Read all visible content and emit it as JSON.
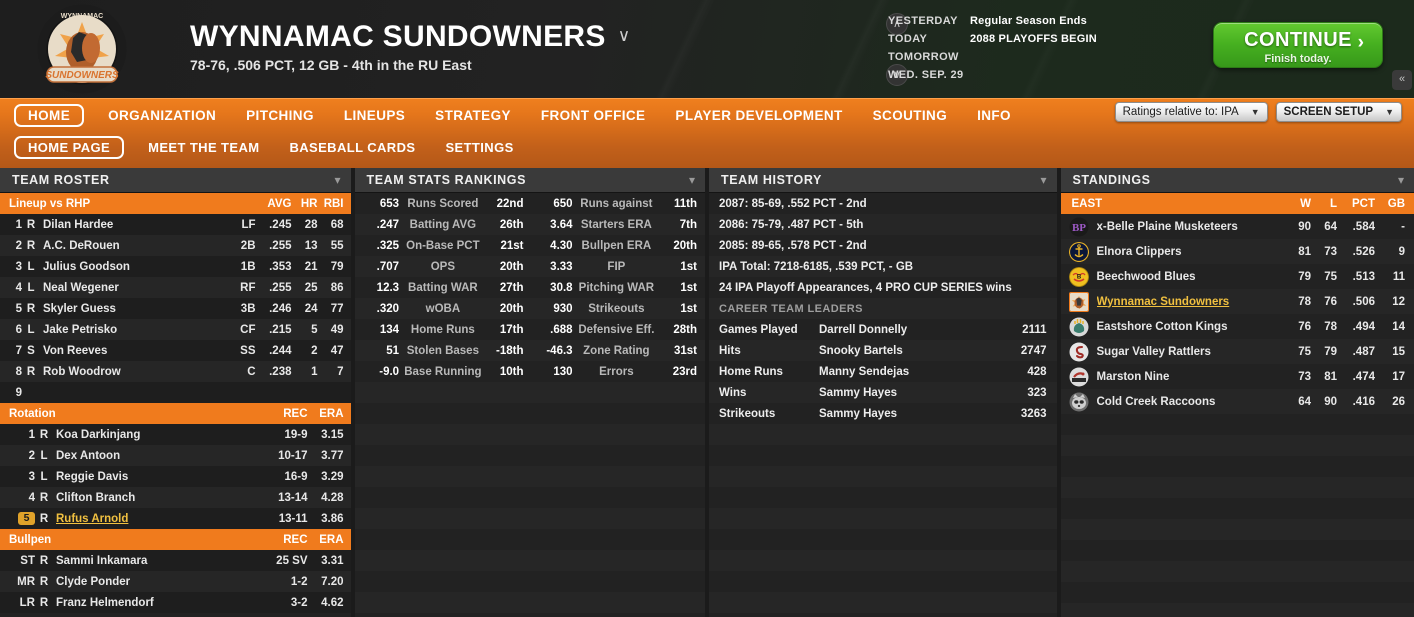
{
  "header": {
    "team_name": "WYNNAMAC SUNDOWNERS",
    "team_record": "78-76, .506 PCT, 12 GB - 4th in the RU East",
    "title_chevron": "chevron-down-icon",
    "dates": [
      {
        "label": "YESTERDAY",
        "value": "Regular Season Ends"
      },
      {
        "label": "TODAY",
        "value": "2088 PLAYOFFS BEGIN"
      },
      {
        "label": "TOMORROW",
        "value": ""
      },
      {
        "label": "WED. SEP. 29",
        "value": ""
      }
    ],
    "continue_label": "CONTINUE",
    "continue_sub": "Finish today.",
    "continue_arrow": "›",
    "collapse_icon": "«",
    "up_icon": "∧",
    "down_icon": "∨",
    "continue_color": "#46b020"
  },
  "nav": {
    "primary": [
      {
        "label": "HOME",
        "active": true
      },
      {
        "label": "ORGANIZATION",
        "active": false
      },
      {
        "label": "PITCHING",
        "active": false
      },
      {
        "label": "LINEUPS",
        "active": false
      },
      {
        "label": "STRATEGY",
        "active": false
      },
      {
        "label": "FRONT OFFICE",
        "active": false
      },
      {
        "label": "PLAYER DEVELOPMENT",
        "active": false
      },
      {
        "label": "SCOUTING",
        "active": false
      },
      {
        "label": "INFO",
        "active": false
      }
    ],
    "secondary": [
      {
        "label": "HOME PAGE",
        "active": true
      },
      {
        "label": "MEET THE TEAM",
        "active": false
      },
      {
        "label": "BASEBALL CARDS",
        "active": false
      },
      {
        "label": "SETTINGS",
        "active": false
      }
    ],
    "ratings_select": "Ratings relative to: IPA",
    "screen_setup_select": "SCREEN SETUP",
    "accent_color": "#ef7f1e"
  },
  "roster": {
    "panel_title": "TEAM ROSTER",
    "lineup_header": {
      "label": "Lineup vs RHP",
      "avg": "AVG",
      "hr": "HR",
      "rbi": "RBI"
    },
    "lineup": [
      {
        "num": "1",
        "hand": "R",
        "name": "Dilan Hardee",
        "pos": "LF",
        "avg": ".245",
        "hr": "28",
        "rbi": "68"
      },
      {
        "num": "2",
        "hand": "R",
        "name": "A.C. DeRouen",
        "pos": "2B",
        "avg": ".255",
        "hr": "13",
        "rbi": "55"
      },
      {
        "num": "3",
        "hand": "L",
        "name": "Julius Goodson",
        "pos": "1B",
        "avg": ".353",
        "hr": "21",
        "rbi": "79"
      },
      {
        "num": "4",
        "hand": "L",
        "name": "Neal Wegener",
        "pos": "RF",
        "avg": ".255",
        "hr": "25",
        "rbi": "86"
      },
      {
        "num": "5",
        "hand": "R",
        "name": "Skyler Guess",
        "pos": "3B",
        "avg": ".246",
        "hr": "24",
        "rbi": "77"
      },
      {
        "num": "6",
        "hand": "L",
        "name": "Jake Petrisko",
        "pos": "CF",
        "avg": ".215",
        "hr": "5",
        "rbi": "49"
      },
      {
        "num": "7",
        "hand": "S",
        "name": "Von Reeves",
        "pos": "SS",
        "avg": ".244",
        "hr": "2",
        "rbi": "47"
      },
      {
        "num": "8",
        "hand": "R",
        "name": "Rob Woodrow",
        "pos": "C",
        "avg": ".238",
        "hr": "1",
        "rbi": "7"
      },
      {
        "num": "9",
        "hand": "",
        "name": "",
        "pos": "",
        "avg": "",
        "hr": "",
        "rbi": ""
      }
    ],
    "rotation_header": {
      "label": "Rotation",
      "rec": "REC",
      "era": "ERA"
    },
    "rotation": [
      {
        "num": "1",
        "hand": "R",
        "name": "Koa Darkinjang",
        "rec": "19-9",
        "era": "3.15",
        "highlight": false
      },
      {
        "num": "2",
        "hand": "L",
        "name": "Dex Antoon",
        "rec": "10-17",
        "era": "3.77",
        "highlight": false
      },
      {
        "num": "3",
        "hand": "L",
        "name": "Reggie Davis",
        "rec": "16-9",
        "era": "3.29",
        "highlight": false
      },
      {
        "num": "4",
        "hand": "R",
        "name": "Clifton Branch",
        "rec": "13-14",
        "era": "4.28",
        "highlight": false
      },
      {
        "num": "5",
        "hand": "R",
        "name": "Rufus Arnold",
        "rec": "13-11",
        "era": "3.86",
        "highlight": true
      }
    ],
    "bullpen_header": {
      "label": "Bullpen",
      "rec": "REC",
      "era": "ERA"
    },
    "bullpen": [
      {
        "num": "ST",
        "hand": "R",
        "name": "Sammi Inkamara",
        "rec": "25 SV",
        "era": "3.31"
      },
      {
        "num": "MR",
        "hand": "R",
        "name": "Clyde Ponder",
        "rec": "1-2",
        "era": "7.20"
      },
      {
        "num": "LR",
        "hand": "R",
        "name": "Franz Helmendorf",
        "rec": "3-2",
        "era": "4.62"
      }
    ]
  },
  "stats": {
    "panel_title": "TEAM STATS RANKINGS",
    "rows": [
      {
        "lval": "653",
        "llbl": "Runs Scored",
        "lrank": "22nd",
        "rval": "650",
        "rlbl": "Runs against",
        "rrank": "11th"
      },
      {
        "lval": ".247",
        "llbl": "Batting AVG",
        "lrank": "26th",
        "rval": "3.64",
        "rlbl": "Starters ERA",
        "rrank": "7th"
      },
      {
        "lval": ".325",
        "llbl": "On-Base PCT",
        "lrank": "21st",
        "rval": "4.30",
        "rlbl": "Bullpen ERA",
        "rrank": "20th"
      },
      {
        "lval": ".707",
        "llbl": "OPS",
        "lrank": "20th",
        "rval": "3.33",
        "rlbl": "FIP",
        "rrank": "1st"
      },
      {
        "lval": "12.3",
        "llbl": "Batting WAR",
        "lrank": "27th",
        "rval": "30.8",
        "rlbl": "Pitching WAR",
        "rrank": "1st"
      },
      {
        "lval": ".320",
        "llbl": "wOBA",
        "lrank": "20th",
        "rval": "930",
        "rlbl": "Strikeouts",
        "rrank": "1st"
      },
      {
        "lval": "134",
        "llbl": "Home Runs",
        "lrank": "17th",
        "rval": ".688",
        "rlbl": "Defensive Eff.",
        "rrank": "28th"
      },
      {
        "lval": "51",
        "llbl": "Stolen Bases",
        "lrank": "-18th",
        "rval": "-46.3",
        "rlbl": "Zone Rating",
        "rrank": "31st"
      },
      {
        "lval": "-9.0",
        "llbl": "Base Running",
        "lrank": "10th",
        "rval": "130",
        "rlbl": "Errors",
        "rrank": "23rd"
      }
    ]
  },
  "history": {
    "panel_title": "TEAM HISTORY",
    "lines": [
      "2087: 85-69, .552 PCT - 2nd",
      "2086: 75-79, .487 PCT - 5th",
      "2085: 89-65, .578 PCT - 2nd",
      "IPA Total: 7218-6185, .539 PCT, - GB",
      "24 IPA Playoff Appearances, 4 PRO CUP SERIES wins"
    ],
    "leaders_header": "CAREER TEAM LEADERS",
    "leaders": [
      {
        "cat": "Games Played",
        "name": "Darrell Donnelly",
        "val": "2111"
      },
      {
        "cat": "Hits",
        "name": "Snooky Bartels",
        "val": "2747"
      },
      {
        "cat": "Home Runs",
        "name": "Manny Sendejas",
        "val": "428"
      },
      {
        "cat": "Wins",
        "name": "Sammy Hayes",
        "val": "323"
      },
      {
        "cat": "Strikeouts",
        "name": "Sammy Hayes",
        "val": "3263"
      }
    ]
  },
  "standings": {
    "panel_title": "STANDINGS",
    "division_header": {
      "division": "EAST",
      "w": "W",
      "l": "L",
      "pct": "PCT",
      "gb": "GB"
    },
    "teams": [
      {
        "logo": "belle-plaine-musketeers-logo",
        "name": "x-Belle Plaine Musketeers",
        "w": "90",
        "l": "64",
        "pct": ".584",
        "gb": "-",
        "me": false,
        "c1": "#1a1a1a",
        "c2": "#9b59c4"
      },
      {
        "logo": "elnora-clippers-logo",
        "name": "Elnora Clippers",
        "w": "81",
        "l": "73",
        "pct": ".526",
        "gb": "9",
        "me": false,
        "c1": "#0a1638",
        "c2": "#e8b227"
      },
      {
        "logo": "beechwood-blues-logo",
        "name": "Beechwood Blues",
        "w": "79",
        "l": "75",
        "pct": ".513",
        "gb": "11",
        "me": false,
        "c1": "#f0c020",
        "c2": "#d23a2a"
      },
      {
        "logo": "wynnamac-sundowners-logo",
        "name": "Wynnamac Sundowners",
        "w": "78",
        "l": "76",
        "pct": ".506",
        "gb": "12",
        "me": true,
        "c1": "#e8dcc8",
        "c2": "#c2703a"
      },
      {
        "logo": "eastshore-cotton-kings-logo",
        "name": "Eastshore Cotton Kings",
        "w": "76",
        "l": "78",
        "pct": ".494",
        "gb": "14",
        "me": false,
        "c1": "#d8d8d8",
        "c2": "#3a7d6e"
      },
      {
        "logo": "sugar-valley-rattlers-logo",
        "name": "Sugar Valley Rattlers",
        "w": "75",
        "l": "79",
        "pct": ".487",
        "gb": "15",
        "me": false,
        "c1": "#e6e6e6",
        "c2": "#9e2b25"
      },
      {
        "logo": "marston-nine-logo",
        "name": "Marston Nine",
        "w": "73",
        "l": "81",
        "pct": ".474",
        "gb": "17",
        "me": false,
        "c1": "#dcdcdc",
        "c2": "#b0352c"
      },
      {
        "logo": "cold-creek-raccoons-logo",
        "name": "Cold Creek Raccoons",
        "w": "64",
        "l": "90",
        "pct": ".416",
        "gb": "26",
        "me": false,
        "c1": "#6e6e6e",
        "c2": "#cfcfcf"
      }
    ]
  }
}
